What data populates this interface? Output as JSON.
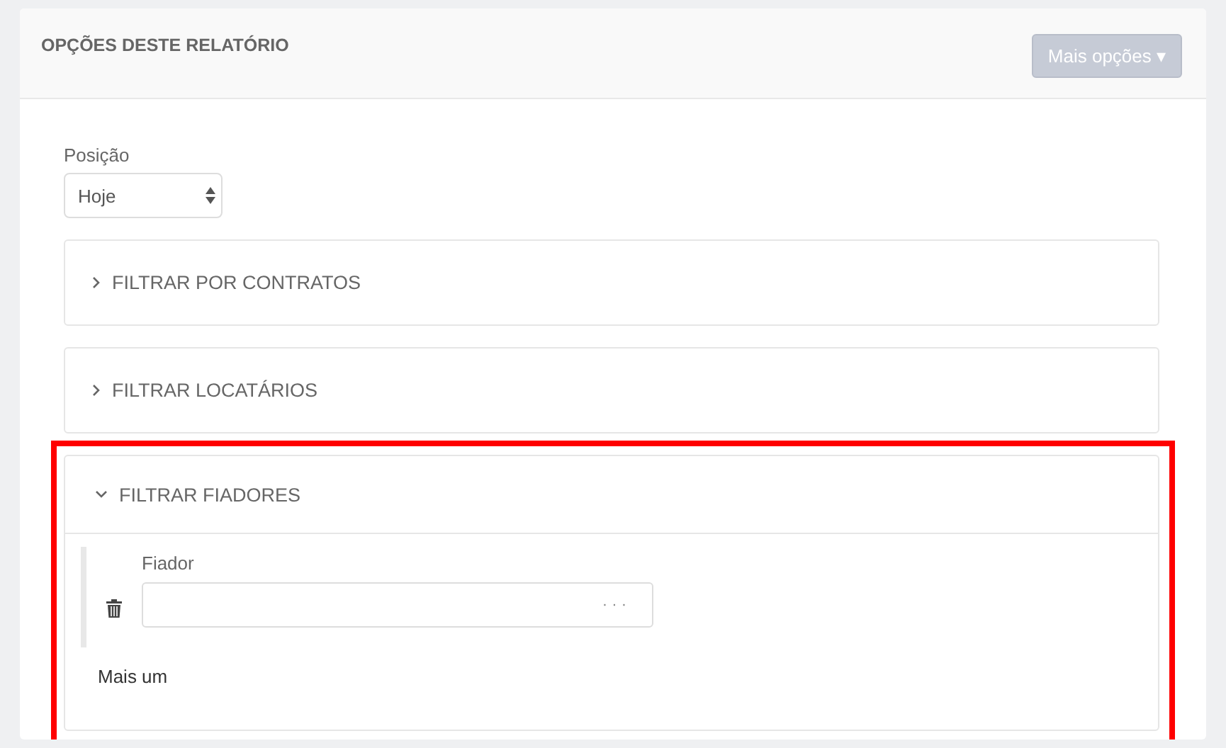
{
  "header": {
    "title": "OPÇÕES DESTE RELATÓRIO",
    "menu_button": {
      "label": "Mais opções",
      "caret": "▾"
    }
  },
  "position": {
    "label": "Posição",
    "value": "Hoje"
  },
  "filters": [
    {
      "title": "FILTRAR POR CONTRATOS",
      "expanded": false,
      "highlighted": false
    },
    {
      "title": "FILTRAR LOCATÁRIOS",
      "expanded": false,
      "highlighted": false
    },
    {
      "title": "FILTRAR FIADORES",
      "expanded": true,
      "highlighted": true,
      "fields": [
        {
          "label": "Fiador",
          "button": "· · ·"
        }
      ],
      "add_link": "Mais um"
    }
  ]
}
